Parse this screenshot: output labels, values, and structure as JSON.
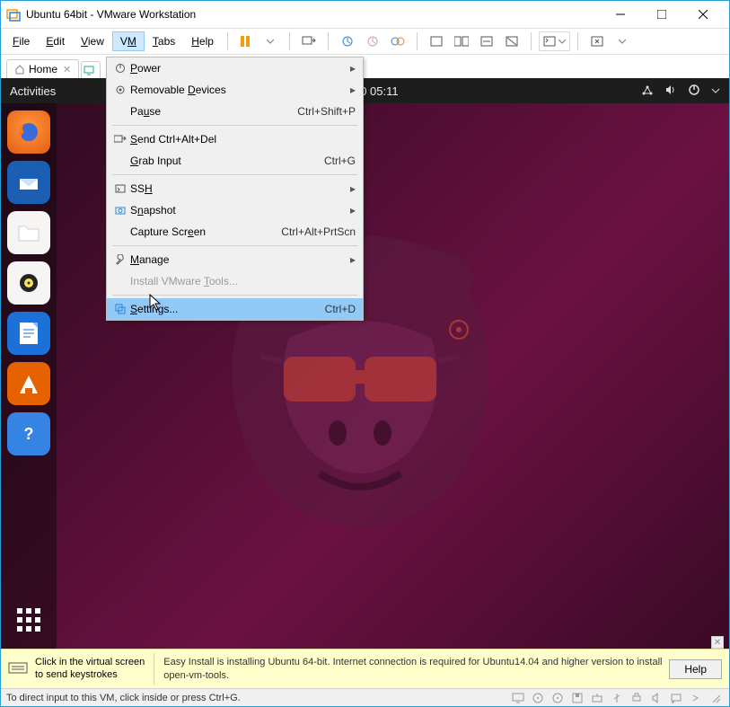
{
  "window": {
    "title": "Ubuntu 64bit - VMware Workstation"
  },
  "menus": {
    "file": "File",
    "edit": "Edit",
    "view": "View",
    "vm": "VM",
    "tabs": "Tabs",
    "help": "Help"
  },
  "tabs": {
    "home": "Home"
  },
  "vmmenu": {
    "power": "Power",
    "removable": "Removable Devices",
    "pause": "Pause",
    "pause_accel": "Ctrl+Shift+P",
    "sendcad": "Send Ctrl+Alt+Del",
    "grab": "Grab Input",
    "grab_accel": "Ctrl+G",
    "ssh": "SSH",
    "snapshot": "Snapshot",
    "capture": "Capture Screen",
    "capture_accel": "Ctrl+Alt+PrtScn",
    "manage": "Manage",
    "installtools": "Install VMware Tools...",
    "settings": "Settings...",
    "settings_accel": "Ctrl+D"
  },
  "ubuntu": {
    "activities": "Activities",
    "datetime": "Jan 10  05:11"
  },
  "yellow": {
    "click_msg1": "Click in the virtual screen",
    "click_msg2": "to send keystrokes",
    "easy_msg": "Easy Install is installing Ubuntu 64-bit. Internet connection is required for Ubuntu14.04 and higher version to install open-vm-tools.",
    "help_btn": "Help"
  },
  "status": {
    "msg": "To direct input to this VM, click inside or press Ctrl+G."
  }
}
